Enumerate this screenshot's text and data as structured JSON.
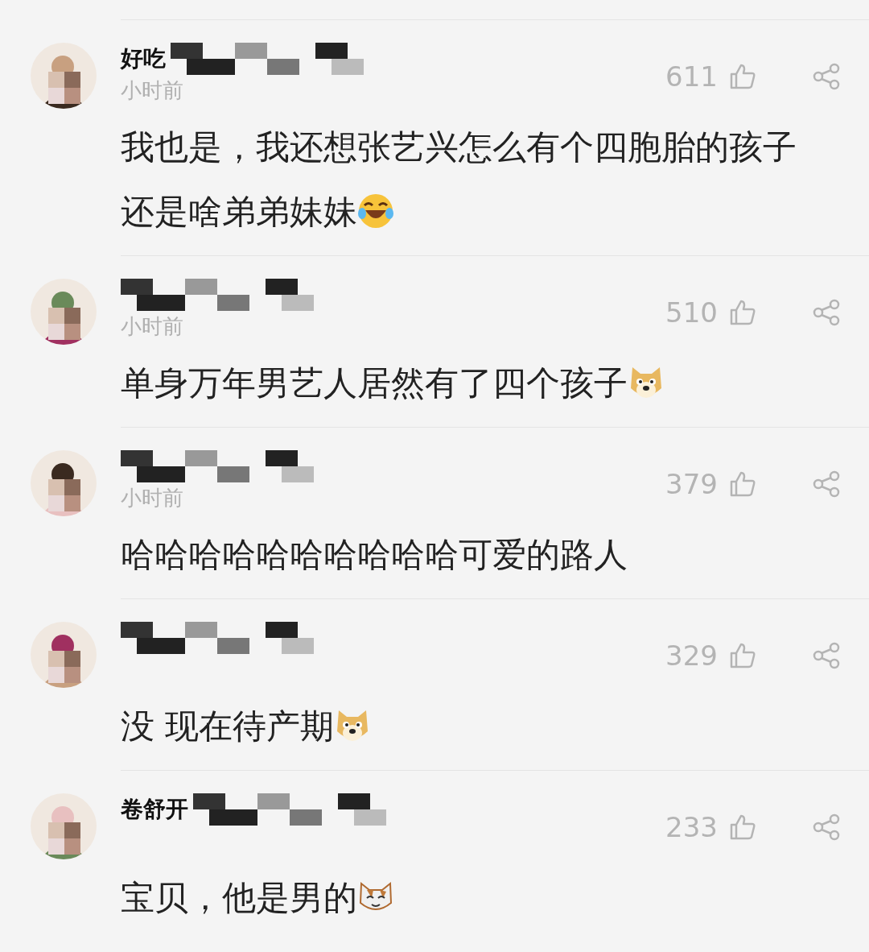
{
  "comments": [
    {
      "kind": "laugh",
      "name": "好吃",
      "time": "小时前",
      "likes": "611",
      "text": "我也是，我还想张艺兴怎么有个四胞胎的孩子还是啥弟弟妹妹"
    },
    {
      "kind": "dog",
      "time": "小时前",
      "likes": "510",
      "text": "单身万年男艺人居然有了四个孩子"
    },
    {
      "kind": "plain",
      "time": "小时前",
      "likes": "379",
      "text": "哈哈哈哈哈哈哈哈哈哈可爱的路人"
    },
    {
      "kind": "dog",
      "likes": "329",
      "text": "没 现在待产期"
    },
    {
      "kind": "cat",
      "name": "卷舒开",
      "likes": "233",
      "text": "宝贝，他是男的"
    }
  ]
}
